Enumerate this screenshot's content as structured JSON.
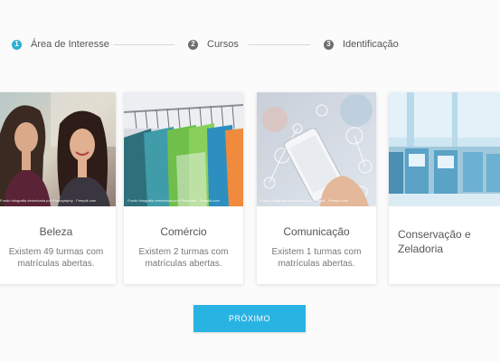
{
  "stepper": {
    "steps": [
      {
        "number": "1",
        "label": "Área de Interesse"
      },
      {
        "number": "2",
        "label": "Cursos"
      },
      {
        "number": "3",
        "label": "Identificação"
      }
    ],
    "active_color": "#2bb0d4",
    "inactive_color": "#6e6e6e"
  },
  "cards": [
    {
      "title": "Beleza",
      "description": "Existem 49 turmas com matrículas abertas.",
      "caption": "Fundo fotografia desenhada por Photography - Freepik.com",
      "image": "two-women-photo"
    },
    {
      "title": "Comércio",
      "description": "Existem 2 turmas com matrículas abertas.",
      "caption": "Fundo fotografia desenhada por Photoduet - Freepik.com",
      "image": "clothes-rack-photo"
    },
    {
      "title": "Comunicação",
      "description": "Existem 1 turmas com matrículas abertas.",
      "caption": "Fundo fotografia desenhada por Freepik - Freepik.com",
      "image": "smartphone-icons-photo"
    },
    {
      "title": "Conservação e Zeladoria",
      "description": "",
      "caption": "",
      "image": "machines-room-photo"
    }
  ],
  "next_button": {
    "label": "PRÓXIMO",
    "color": "#29b3e3"
  }
}
